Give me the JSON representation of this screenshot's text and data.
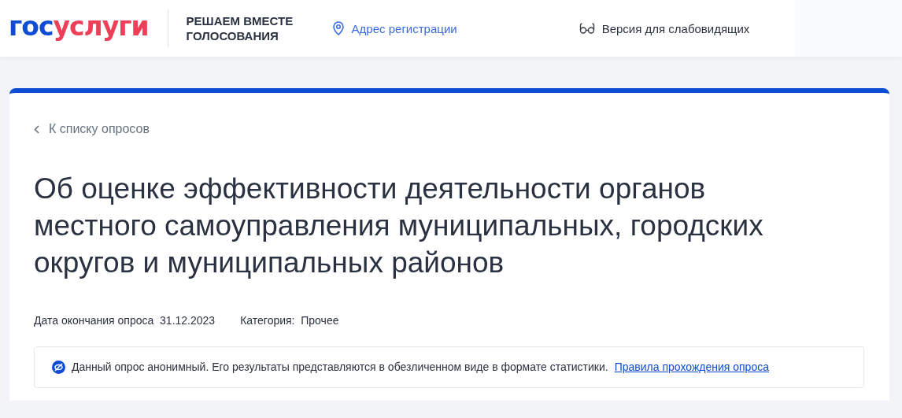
{
  "header": {
    "logo": {
      "first": "гос",
      "second": "услуги"
    },
    "tagline": [
      "РЕШАЕМ ВМЕСТЕ",
      "ГОЛОСОВАНИЯ"
    ],
    "address_link": "Адрес регистрации",
    "accessibility_link": "Версия для слабовидящих"
  },
  "poll": {
    "back_link": "К списку опросов",
    "title": "Об оценке эффективности деятельности органов местного самоуправления муниципальных, городских округов и муниципальных районов",
    "meta": [
      {
        "label": "Дата окончания опроса",
        "value": "31.12.2023"
      },
      {
        "label": "Категория:",
        "value": "Прочее"
      }
    ],
    "notice": {
      "text": "Данный опрос анонимный. Его результаты представляются в обезличенном виде в формате статистики.",
      "link": "Правила прохождения опроса"
    }
  }
}
